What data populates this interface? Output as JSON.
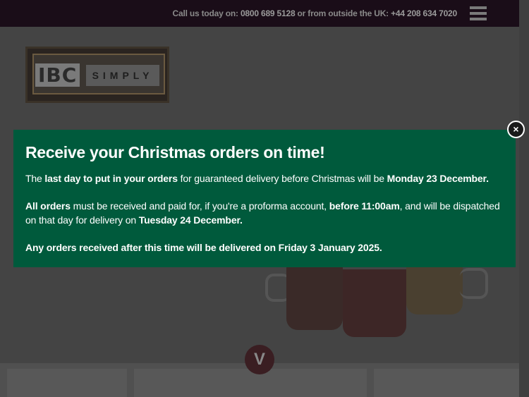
{
  "topbar": {
    "call_prefix": "Call us today on: ",
    "uk_number": "0800 689 5128",
    "call_middle": " or from outside the UK: ",
    "intl_number": "+44 208 634 7020"
  },
  "logo": {
    "ibc": "IBC",
    "simply": "SIMPLY"
  },
  "scroll_down": {
    "glyph": "V"
  },
  "modal": {
    "title": "Receive your Christmas orders on time!",
    "p1": {
      "t1": "The ",
      "b1": "last day to put in your orders",
      "t2": " for guaranteed delivery before Christmas will be ",
      "b2": "Monday 23 December."
    },
    "p2": {
      "b1": "All orders",
      "t1": " must be received and paid for, if you're a proforma account, ",
      "b2": "before 11:00am",
      "t2": ", and will be dispatched on that day for delivery on ",
      "b3": "Tuesday 24 December."
    },
    "p3": {
      "b1": "Any orders received after this time will be delivered on Friday 3 January 2025."
    },
    "close_glyph": "×",
    "bg_color": "#005a3c"
  }
}
